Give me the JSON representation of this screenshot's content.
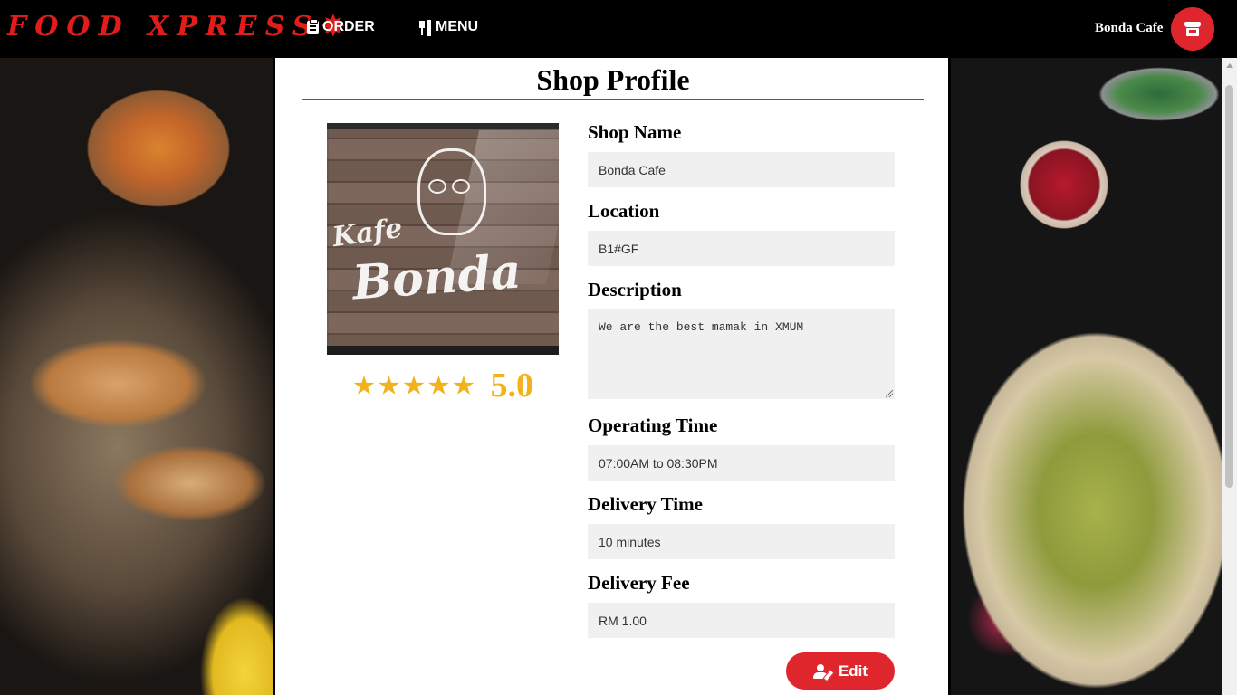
{
  "nav": {
    "logo": "FOOD XPRESS",
    "logo_mark": "✸",
    "order_label": "ORDER",
    "menu_label": "MENU",
    "shop_name": "Bonda Cafe"
  },
  "page": {
    "title": "Shop Profile"
  },
  "photo": {
    "text_line1": "Kafe",
    "text_line2": "Bonda"
  },
  "rating": {
    "stars": 5,
    "value": "5.0"
  },
  "form": {
    "shop_name_label": "Shop Name",
    "shop_name_value": "Bonda Cafe",
    "location_label": "Location",
    "location_value": "B1#GF",
    "description_label": "Description",
    "description_value": "We are the best mamak in XMUM",
    "operating_time_label": "Operating Time",
    "operating_time_value": "07:00AM to 08:30PM",
    "delivery_time_label": "Delivery Time",
    "delivery_time_value": "10 minutes",
    "delivery_fee_label": "Delivery Fee",
    "delivery_fee_value": "RM 1.00",
    "edit_label": "Edit"
  },
  "colors": {
    "accent": "#e0262d",
    "star": "#f2b21c",
    "field_bg": "#f0f0f0"
  }
}
